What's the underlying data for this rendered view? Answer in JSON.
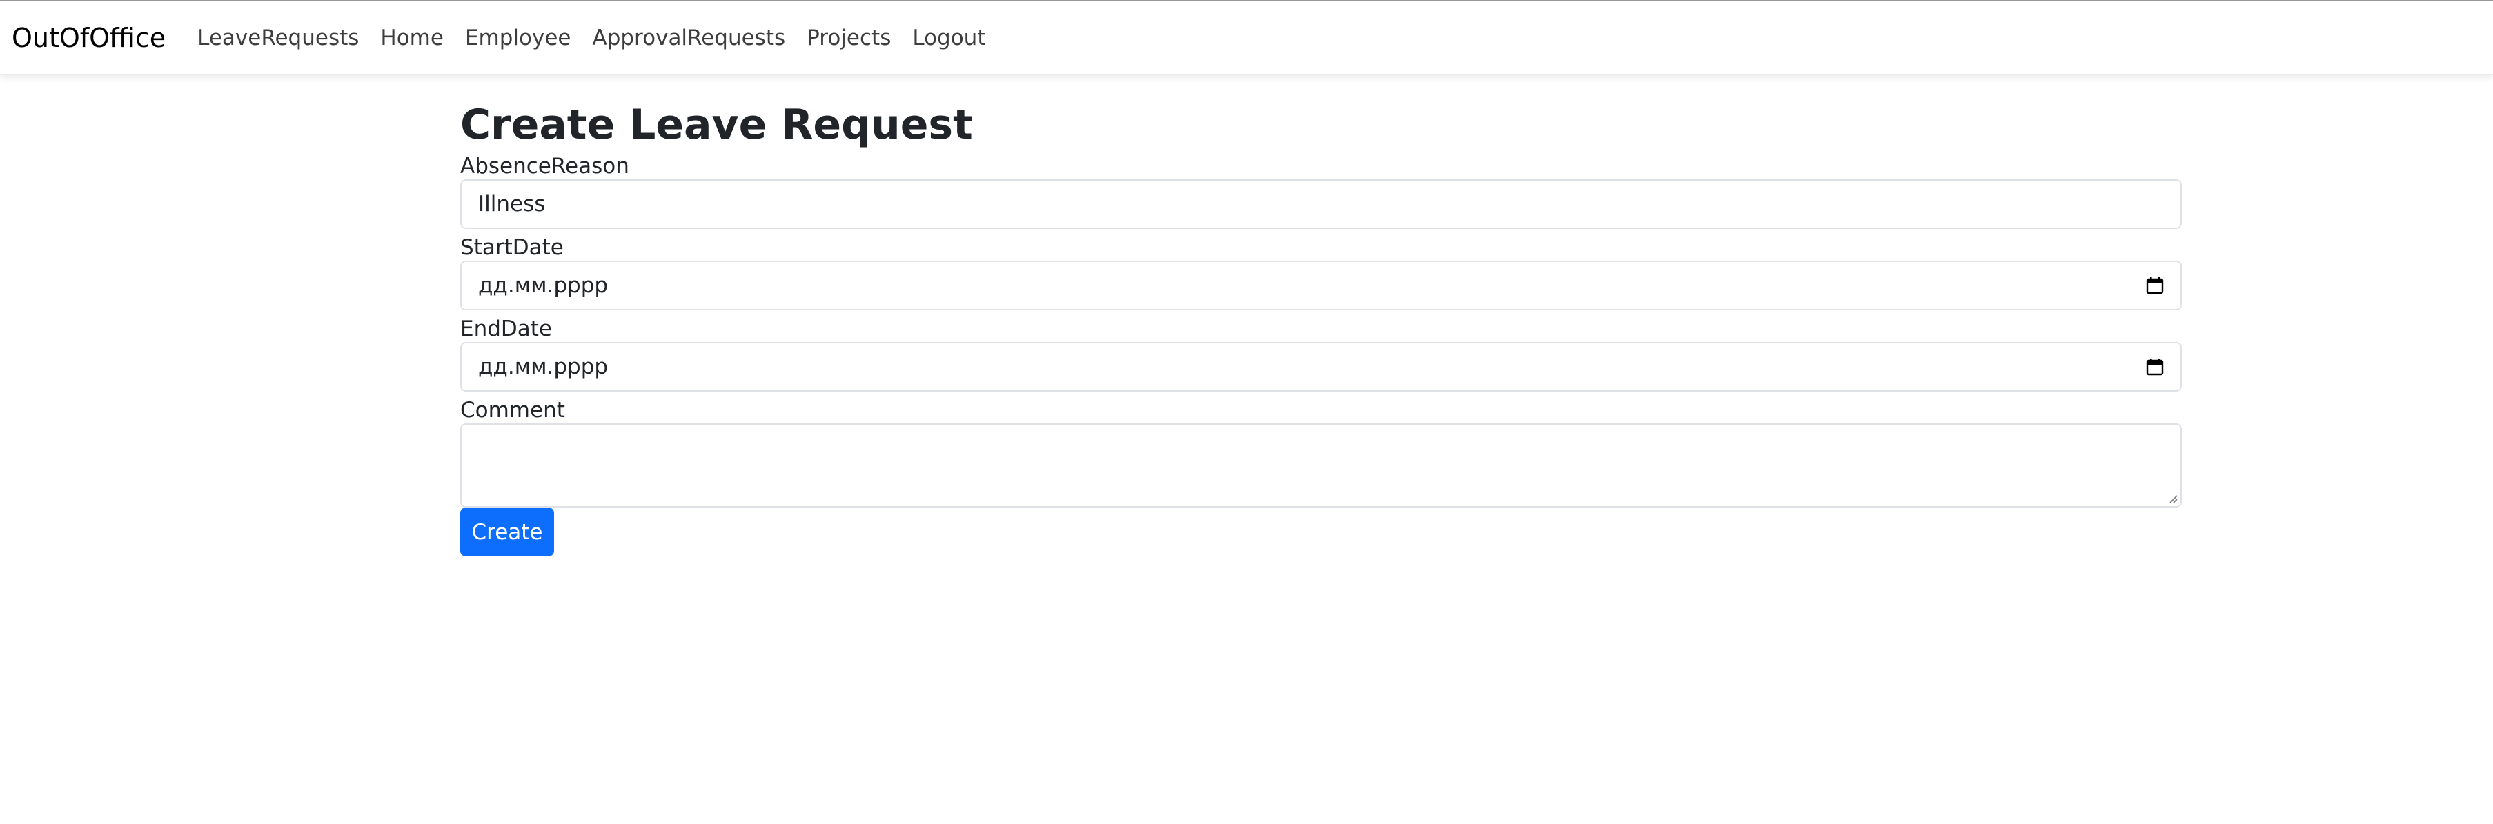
{
  "navbar": {
    "brand": "OutOfOffice",
    "links": [
      "LeaveRequests",
      "Home",
      "Employee",
      "ApprovalRequests",
      "Projects",
      "Logout"
    ]
  },
  "form": {
    "title": "Create Leave Request",
    "absence_reason": {
      "label": "AbsenceReason",
      "value": "Illness"
    },
    "start_date": {
      "label": "StartDate",
      "value": "дд.мм.рррр",
      "icon": "calendar-icon"
    },
    "end_date": {
      "label": "EndDate",
      "value": "дд.мм.рррр",
      "icon": "calendar-icon"
    },
    "comment": {
      "label": "Comment",
      "value": ""
    },
    "submit_label": "Create"
  },
  "colors": {
    "primary": "#0d6efd",
    "border": "#dee2e6",
    "text": "#212529"
  }
}
